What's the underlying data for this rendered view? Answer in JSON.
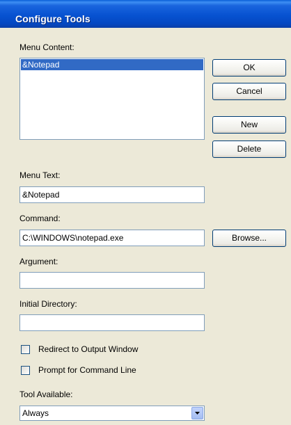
{
  "window": {
    "title": "Configure Tools"
  },
  "menu_content": {
    "label": "Menu Content:",
    "items": [
      "&Notepad"
    ],
    "selected_index": 0
  },
  "buttons": {
    "ok": "OK",
    "cancel": "Cancel",
    "new": "New",
    "delete": "Delete",
    "browse": "Browse..."
  },
  "menu_text": {
    "label": "Menu Text:",
    "value": "&Notepad"
  },
  "command": {
    "label": "Command:",
    "value": "C:\\WINDOWS\\notepad.exe"
  },
  "argument": {
    "label": "Argument:",
    "value": ""
  },
  "initial_directory": {
    "label": "Initial Directory:",
    "value": ""
  },
  "checkboxes": {
    "redirect": {
      "label": "Redirect to Output Window",
      "checked": false
    },
    "prompt": {
      "label": "Prompt for Command Line",
      "checked": false
    }
  },
  "tool_available": {
    "label": "Tool Available:",
    "value": "Always"
  },
  "colors": {
    "title_bar": "#0752d1",
    "selection": "#316ac5",
    "dialog_bg": "#ece9d8"
  }
}
